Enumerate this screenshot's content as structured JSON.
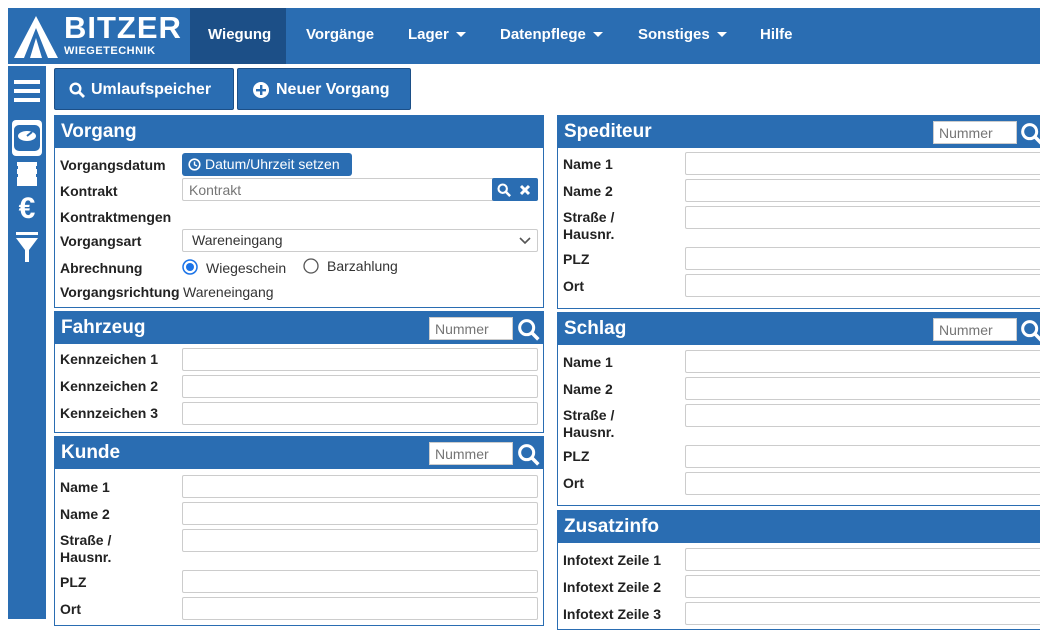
{
  "brand": {
    "name": "BITZER",
    "subtitle": "WIEGETECHNIK"
  },
  "nav": {
    "items": [
      {
        "label": "Wiegung",
        "active": true
      },
      {
        "label": "Vorgänge"
      },
      {
        "label": "Lager"
      },
      {
        "label": "Datenpflege"
      },
      {
        "label": "Sonstiges"
      },
      {
        "label": "Hilfe"
      }
    ]
  },
  "sidebar": {
    "icons": [
      "menu-icon",
      "scale-icon",
      "receipt-icon",
      "euro-icon",
      "filter-icon"
    ]
  },
  "toolbar": {
    "umlauf_label": "Umlaufspeicher",
    "neuer_label": "Neuer Vorgang"
  },
  "vorgang": {
    "title": "Vorgang",
    "datum_label": "Vorgangsdatum",
    "datum_button": "Datum/Uhrzeit setzen",
    "kontrakt_label": "Kontrakt",
    "kontrakt_placeholder": "Kontrakt",
    "kontraktmengen_label": "Kontraktmengen",
    "vorgangsart_label": "Vorgangsart",
    "vorgangsart_value": "Wareneingang",
    "abrechnung_label": "Abrechnung",
    "abrechnung_options": [
      "Wiegeschein",
      "Barzahlung"
    ],
    "abrechnung_selected": "Wiegeschein",
    "richtung_label": "Vorgangsrichtung",
    "richtung_value": "Wareneingang"
  },
  "fahrzeug": {
    "title": "Fahrzeug",
    "number_placeholder": "Nummer",
    "fields": [
      "Kennzeichen 1",
      "Kennzeichen 2",
      "Kennzeichen 3"
    ]
  },
  "kunde": {
    "title": "Kunde",
    "number_placeholder": "Nummer",
    "fields": [
      "Name 1",
      "Name 2",
      "Straße /",
      "Hausnr.",
      "PLZ",
      "Ort"
    ]
  },
  "spediteur": {
    "title": "Spediteur",
    "number_placeholder": "Nummer",
    "fields": [
      "Name 1",
      "Name 2",
      "Straße /",
      "Hausnr.",
      "PLZ",
      "Ort"
    ]
  },
  "schlag": {
    "title": "Schlag",
    "number_placeholder": "Nummer",
    "fields": [
      "Name 1",
      "Name 2",
      "Straße /",
      "Hausnr.",
      "PLZ",
      "Ort"
    ]
  },
  "zusatzinfo": {
    "title": "Zusatzinfo",
    "fields": [
      "Infotext Zeile 1",
      "Infotext Zeile 2",
      "Infotext Zeile 3"
    ]
  },
  "colors": {
    "primary": "#2a6db2",
    "primary_dark": "#1c4f87"
  }
}
